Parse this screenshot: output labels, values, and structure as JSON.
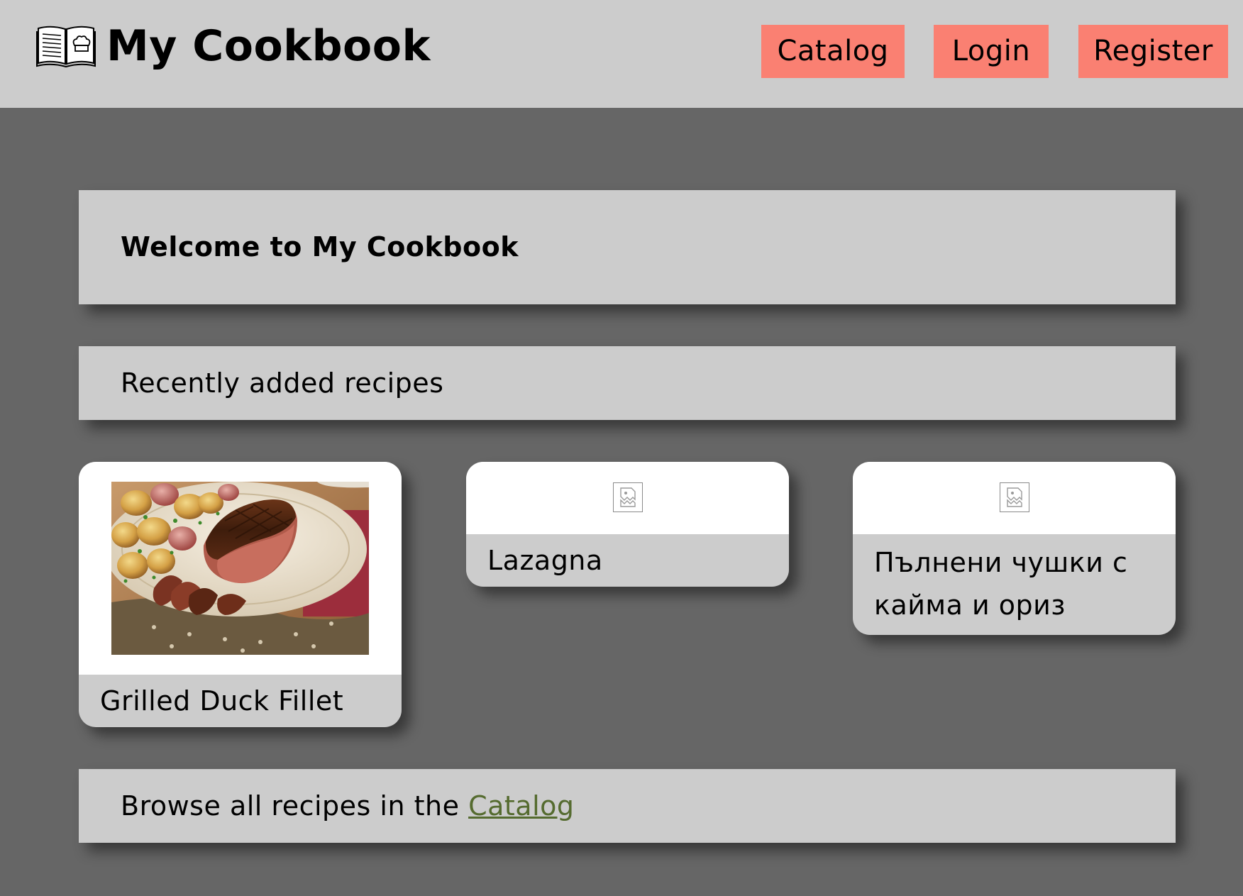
{
  "header": {
    "logo_text": "My Cookbook",
    "nav": {
      "catalog": "Catalog",
      "login": "Login",
      "register": "Register"
    }
  },
  "welcome": {
    "title": "Welcome to My Cookbook"
  },
  "recent": {
    "title": "Recently added recipes",
    "recipes": [
      {
        "name": "Grilled Duck Fillet",
        "image": "photo"
      },
      {
        "name": "Lazagna",
        "image": "broken-image-icon"
      },
      {
        "name": "Пълнени чушки с кайма и ориз",
        "image": "broken-image-icon"
      }
    ]
  },
  "browse": {
    "prefix": "Browse all recipes in the ",
    "link": "Catalog"
  },
  "colors": {
    "page_bg": "#666666",
    "panel_bg": "#cccccc",
    "nav_button": "#fa8072",
    "link": "#556b2f"
  }
}
